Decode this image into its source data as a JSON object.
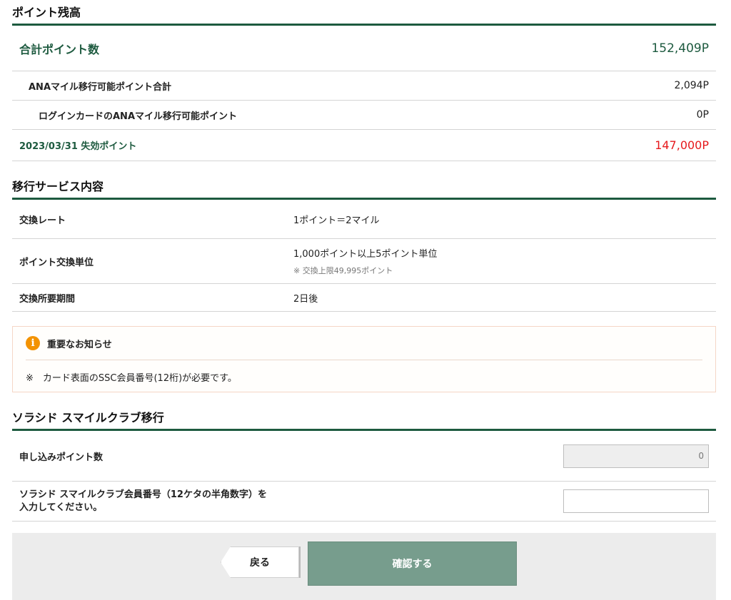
{
  "balance": {
    "title": "ポイント残高",
    "total_label": "合計ポイント数",
    "total_value": "152,409P",
    "ana_label": "ANAマイル移行可能ポイント合計",
    "ana_value": "2,094P",
    "login_label": "ログインカードのANAマイル移行可能ポイント",
    "login_value": "0P",
    "expire_label": "2023/03/31 失効ポイント",
    "expire_value": "147,000P"
  },
  "service": {
    "title": "移行サービス内容",
    "rate_label": "交換レート",
    "rate_value": "1ポイント＝2マイル",
    "unit_label": "ポイント交換単位",
    "unit_value": "1,000ポイント以上5ポイント単位",
    "unit_note": "※ 交換上限49,995ポイント",
    "period_label": "交換所要期間",
    "period_value": "2日後"
  },
  "notice": {
    "icon": "info-icon",
    "title": "重要なお知らせ",
    "body": "※　カード表面のSSC会員番号(12桁)が必要です。"
  },
  "transfer": {
    "title": "ソラシド スマイルクラブ移行",
    "points_label": "申し込みポイント数",
    "points_value": "0",
    "member_label_line1": "ソラシド スマイルクラブ会員番号（12ケタの半角数字）を",
    "member_label_line2": "入力してください。",
    "member_value": ""
  },
  "actions": {
    "back_label": "戻る",
    "confirm_label": "確認する"
  }
}
